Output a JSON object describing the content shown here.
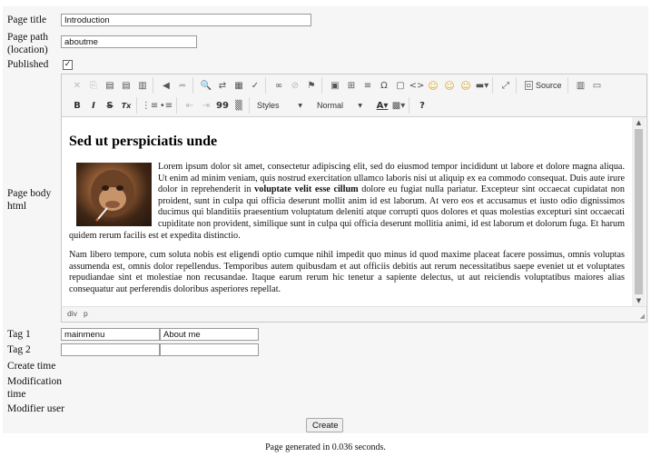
{
  "form": {
    "page_title_label": "Page title",
    "page_title_value": "Introduction",
    "page_path_label_line1": "Page path",
    "page_path_label_line2": "(location)",
    "page_path_value": "aboutme",
    "published_label": "Published",
    "published_mark": "✓",
    "page_body_label_line1": "Page body",
    "page_body_label_line2": "html",
    "tag1_label": "Tag 1",
    "tag1_value_a": "mainmenu",
    "tag1_value_b": "About me",
    "tag2_label": "Tag 2",
    "tag2_value_a": "",
    "tag2_value_b": "",
    "create_time_label": "Create time",
    "modification_time_label_line1": "Modification",
    "modification_time_label_line2": "time",
    "modifier_user_label": "Modifier user",
    "create_button": "Create"
  },
  "editor": {
    "toolbar": {
      "cut_icon": "✕",
      "copy_icon": "⎘",
      "paste_icon": "📋",
      "source_label": "Source",
      "styles_label": "Styles",
      "format_label": "Normal",
      "bold_glyph": "B",
      "italic_glyph": "I",
      "strike_glyph": "S",
      "remove_format_glyph": "Tx",
      "blockquote_glyph": "99",
      "help_glyph": "?"
    },
    "content": {
      "heading": "Sed ut perspiciatis unde",
      "p1_before_bold": "Lorem ipsum dolor sit amet, consectetur adipiscing elit, sed do eiusmod tempor incididunt ut labore et dolore magna aliqua. Ut enim ad minim veniam, quis nostrud exercitation ullamco laboris nisi ut aliquip ex ea commodo consequat. Duis aute irure dolor in reprehenderit in ",
      "p1_bold": "voluptate velit esse cillum",
      "p1_after_bold": " dolore eu fugiat nulla pariatur. Excepteur sint occaecat cupidatat non proident, sunt in culpa qui officia deserunt mollit anim id est laborum.  At vero eos et accusamus et iusto odio dignissimos ducimus qui blanditiis praesentium voluptatum deleniti atque corrupti quos dolores et quas molestias excepturi sint occaecati cupiditate non provident, similique sunt in culpa qui officia deserunt mollitia animi, id est laborum et dolorum fuga. Et harum quidem rerum facilis est et expedita distinctio.",
      "p2": "Nam libero tempore, cum soluta nobis est eligendi optio cumque nihil impedit quo minus id quod maxime placeat facere possimus, omnis voluptas assumenda est, omnis dolor repellendus. Temporibus autem quibusdam et aut officiis debitis aut rerum necessitatibus saepe eveniet ut et voluptates repudiandae sint et molestiae non recusandae. Itaque earum rerum hic tenetur a sapiente delectus, ut aut reiciendis voluptatibus maiores alias consequatur aut perferendis doloribus asperiores repellat."
    },
    "path": [
      "div",
      "p"
    ]
  },
  "footer": {
    "text": "Page generated in 0.036 seconds."
  }
}
